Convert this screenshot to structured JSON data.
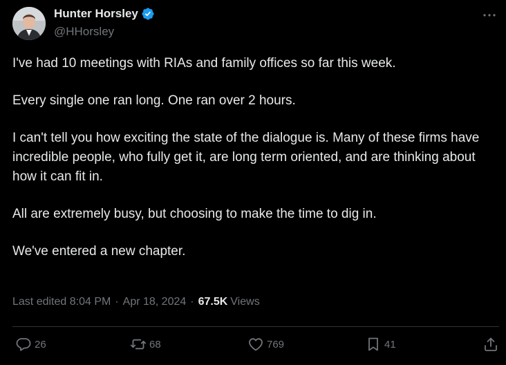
{
  "author": {
    "display_name": "Hunter Horsley",
    "handle": "@HHorsley",
    "verified": true
  },
  "tweet": {
    "paragraphs": [
      "I've had 10 meetings with RIAs and family offices so far this week.",
      "Every single one ran long. One ran over 2 hours.",
      "I can't tell you how exciting the state of the dialogue is. Many of these firms have incredible people, who fully get it, are long term oriented, and are thinking about how it can fit in.",
      "All are extremely busy, but choosing to make the time to dig in.",
      "We've entered a new chapter."
    ],
    "edited_label": "Last edited 8:04 PM",
    "date": "Apr 18, 2024",
    "separator": "·",
    "views_count": "67.5K",
    "views_label": "Views"
  },
  "actions": {
    "replies": "26",
    "reposts": "68",
    "likes": "769",
    "bookmarks": "41"
  },
  "icons": {
    "more": "more-icon",
    "verified": "verified-badge-icon",
    "reply": "reply-icon",
    "repost": "repost-icon",
    "like": "heart-icon",
    "bookmark": "bookmark-icon",
    "share": "share-icon"
  },
  "colors": {
    "background": "#000000",
    "text": "#e7e9ea",
    "muted": "#71767b",
    "verified": "#1d9bf0",
    "divider": "#2f3336"
  }
}
